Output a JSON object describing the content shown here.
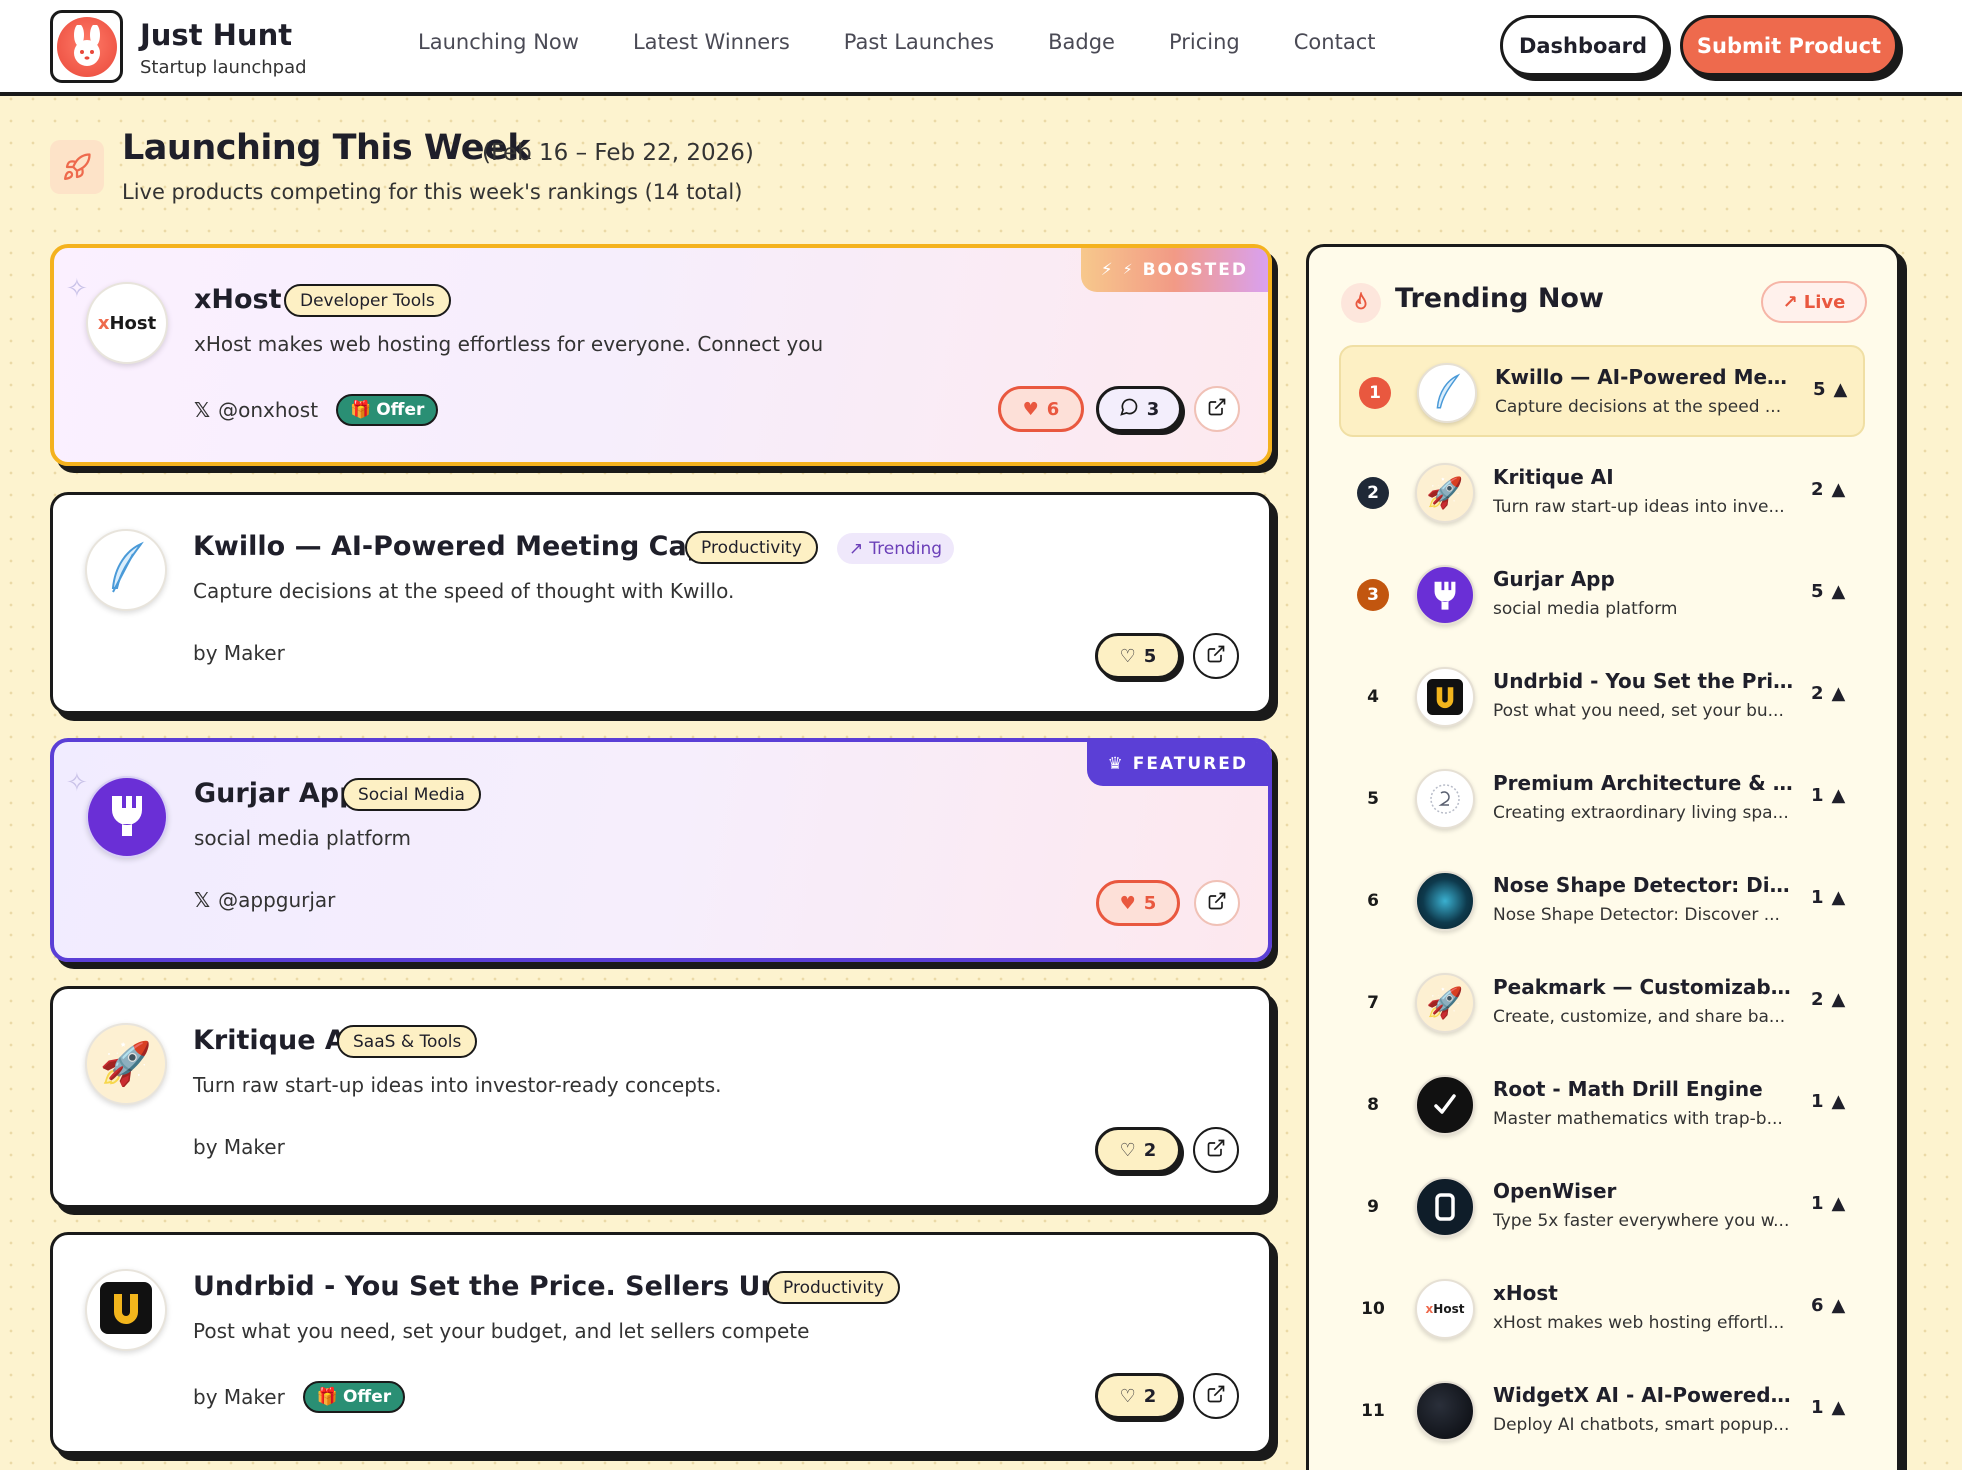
{
  "brand": {
    "name": "Just Hunt",
    "tagline": "Startup launchpad"
  },
  "nav": [
    "Launching Now",
    "Latest Winners",
    "Past Launches",
    "Badge",
    "Pricing",
    "Contact"
  ],
  "header_buttons": {
    "dashboard": "Dashboard",
    "submit": "Submit Product"
  },
  "page": {
    "title": "Launching This Week",
    "range": "(Feb 16 – Feb 22, 2026)",
    "subtitle": "Live products competing for this week's rankings (14 total)"
  },
  "products": [
    {
      "name": "xHost",
      "tag": "Developer Tools",
      "desc": "xHost makes web hosting effortless for everyone. Connect you",
      "by": "@onxhost",
      "offer": "Offer",
      "likes": "6",
      "comments": "3",
      "ribbon": "BOOSTED",
      "logo_text": "xHost"
    },
    {
      "name": "Kwillo — AI-Powered Meeting Capture",
      "tag": "Productivity",
      "trend_tag": "Trending",
      "desc": "Capture decisions at the speed of thought with Kwillo.",
      "by": "by Maker",
      "likes": "5"
    },
    {
      "name": "Gurjar App",
      "tag": "Social Media",
      "desc": "social media platform",
      "by": "@appgurjar",
      "likes": "5",
      "ribbon": "FEATURED"
    },
    {
      "name": "Kritique AI",
      "tag": "SaaS & Tools",
      "desc": "Turn raw start-up ideas into investor-ready concepts.",
      "by": "by Maker",
      "likes": "2"
    },
    {
      "name": "Undrbid - You Set the Price. Sellers Undrbid.",
      "tag": "Productivity",
      "desc": "Post what you need, set your budget, and let sellers compete",
      "by": "by Maker",
      "offer": "Offer",
      "likes": "2"
    }
  ],
  "trending": {
    "title": "Trending Now",
    "live": "Live",
    "items": [
      {
        "rank": "1",
        "name": "Kwillo — AI-Powered Meeti...",
        "desc": "Capture decisions at the speed ...",
        "votes": "5"
      },
      {
        "rank": "2",
        "name": "Kritique AI",
        "desc": "Turn raw start-up ideas into inve...",
        "votes": "2"
      },
      {
        "rank": "3",
        "name": "Gurjar App",
        "desc": "social media platform",
        "votes": "5"
      },
      {
        "rank": "4",
        "name": "Undrbid - You Set the Pric...",
        "desc": "Post what you need, set your bu...",
        "votes": "2"
      },
      {
        "rank": "5",
        "name": "Premium Architecture & In...",
        "desc": "Creating extraordinary living spa...",
        "votes": "1"
      },
      {
        "rank": "6",
        "name": "Nose Shape Detector: Disc...",
        "desc": "Nose Shape Detector: Discover ...",
        "votes": "1"
      },
      {
        "rank": "7",
        "name": "Peakmark — Customizable ...",
        "desc": "Create, customize, and share ba...",
        "votes": "2"
      },
      {
        "rank": "8",
        "name": "Root - Math Drill Engine",
        "desc": "Master mathematics with trap-b...",
        "votes": "1"
      },
      {
        "rank": "9",
        "name": "OpenWiser",
        "desc": "Type 5x faster everywhere you w...",
        "votes": "1"
      },
      {
        "rank": "10",
        "name": "xHost",
        "desc": "xHost makes web hosting effortl...",
        "votes": "6",
        "logo_text": "xHost"
      },
      {
        "rank": "11",
        "name": "WidgetX AI - AI-Powered ...",
        "desc": "Deploy AI chatbots, smart popup...",
        "votes": "1"
      }
    ]
  },
  "colors": {
    "accent": "#ee6a4d",
    "featured": "#5b3fd6",
    "boost_border": "#f4b21e",
    "offer": "#2a8f74",
    "background": "#fdf3cf"
  }
}
